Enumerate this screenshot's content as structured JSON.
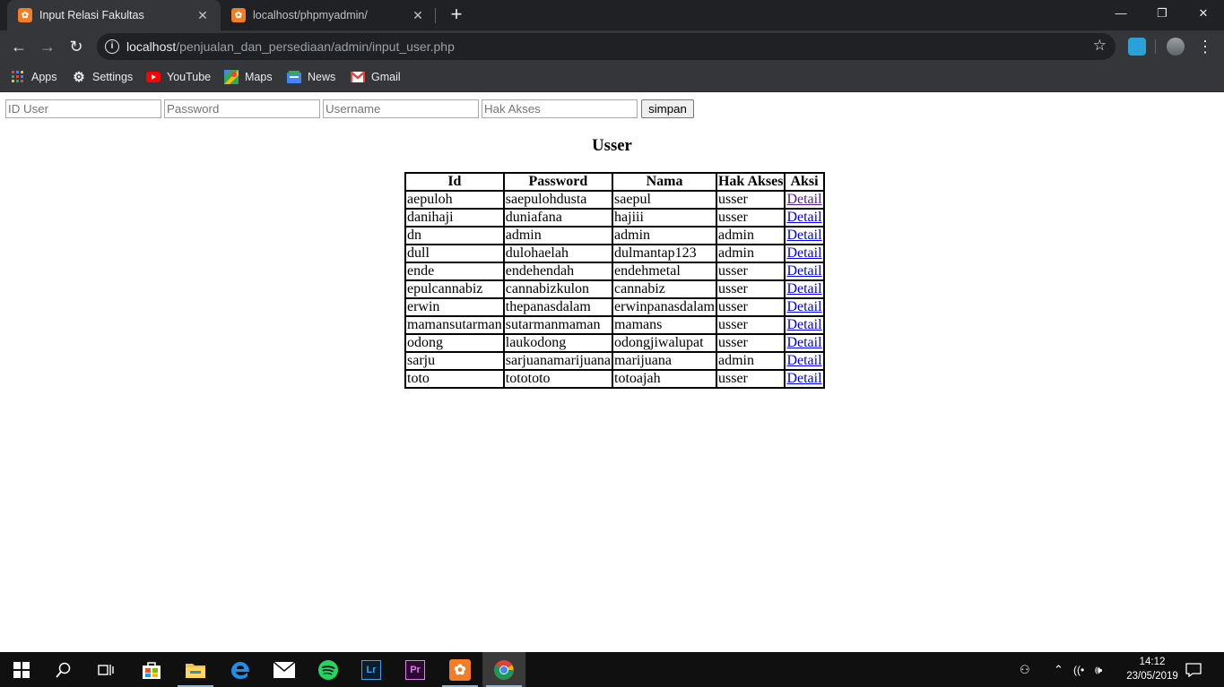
{
  "browser": {
    "tabs": [
      {
        "title": "Input Relasi Fakultas",
        "favicon": "xampp-icon",
        "active": true
      },
      {
        "title": "localhost/phpmyadmin/",
        "favicon": "xampp-icon",
        "active": false
      }
    ],
    "new_tab": "+",
    "window_controls": {
      "minimize": "—",
      "maximize": "❐",
      "close": "✕"
    },
    "url_host": "localhost",
    "url_path": "/penjualan_dan_persediaan/admin/input_user.php",
    "bookmarks": [
      {
        "label": "Apps",
        "icon": "apps-grid-icon"
      },
      {
        "label": "Settings",
        "icon": "gear-icon"
      },
      {
        "label": "YouTube",
        "icon": "youtube-icon"
      },
      {
        "label": "Maps",
        "icon": "maps-icon"
      },
      {
        "label": "News",
        "icon": "news-icon"
      },
      {
        "label": "Gmail",
        "icon": "gmail-icon"
      }
    ]
  },
  "form": {
    "id_placeholder": "ID User",
    "password_placeholder": "Password",
    "username_placeholder": "Username",
    "hak_placeholder": "Hak Akses",
    "submit_label": "simpan"
  },
  "heading": "Usser",
  "table": {
    "headers": [
      "Id",
      "Password",
      "Nama",
      "Hak Akses",
      "Aksi"
    ],
    "rows": [
      {
        "id": "aepuloh",
        "password": "saepulohdusta",
        "nama": "saepul",
        "hak": "usser",
        "aksi": "Detail"
      },
      {
        "id": "danihaji",
        "password": "duniafana",
        "nama": "hajiii",
        "hak": "usser",
        "aksi": "Detail"
      },
      {
        "id": "dn",
        "password": "admin",
        "nama": "admin",
        "hak": "admin",
        "aksi": "Detail"
      },
      {
        "id": "dull",
        "password": "dulohaelah",
        "nama": "dulmantap123",
        "hak": "admin",
        "aksi": "Detail"
      },
      {
        "id": "ende",
        "password": "endehendah",
        "nama": "endehmetal",
        "hak": "usser",
        "aksi": "Detail"
      },
      {
        "id": "epulcannabiz",
        "password": "cannabizkulon",
        "nama": "cannabiz",
        "hak": "usser",
        "aksi": "Detail"
      },
      {
        "id": "erwin",
        "password": "thepanasdalam",
        "nama": "erwinpanasdalam",
        "hak": "usser",
        "aksi": "Detail"
      },
      {
        "id": "mamansutarman",
        "password": "sutarmanmaman",
        "nama": "mamans",
        "hak": "usser",
        "aksi": "Detail"
      },
      {
        "id": "odong",
        "password": "laukodong",
        "nama": "odongjiwalupat",
        "hak": "usser",
        "aksi": "Detail"
      },
      {
        "id": "sarju",
        "password": "sarjuanamarijuana",
        "nama": "marijuana",
        "hak": "admin",
        "aksi": "Detail"
      },
      {
        "id": "toto",
        "password": "totototo",
        "nama": "totoajah",
        "hak": "usser",
        "aksi": "Detail"
      }
    ]
  },
  "taskbar": {
    "apps": [
      "windows-start-icon",
      "search-icon",
      "task-view-icon",
      "store-icon",
      "file-explorer-icon",
      "edge-icon",
      "mail-icon",
      "spotify-icon",
      "lightroom-icon",
      "premiere-icon",
      "xampp-icon",
      "chrome-icon"
    ],
    "lr_label": "Lr",
    "pr_label": "Pr",
    "time": "14:12",
    "date": "23/05/2019"
  },
  "colors": {
    "link": "#0000ee",
    "visited": "#551a8b",
    "chrome_dark": "#202124",
    "chrome_toolbar": "#35363a",
    "taskbar": "#101010"
  }
}
